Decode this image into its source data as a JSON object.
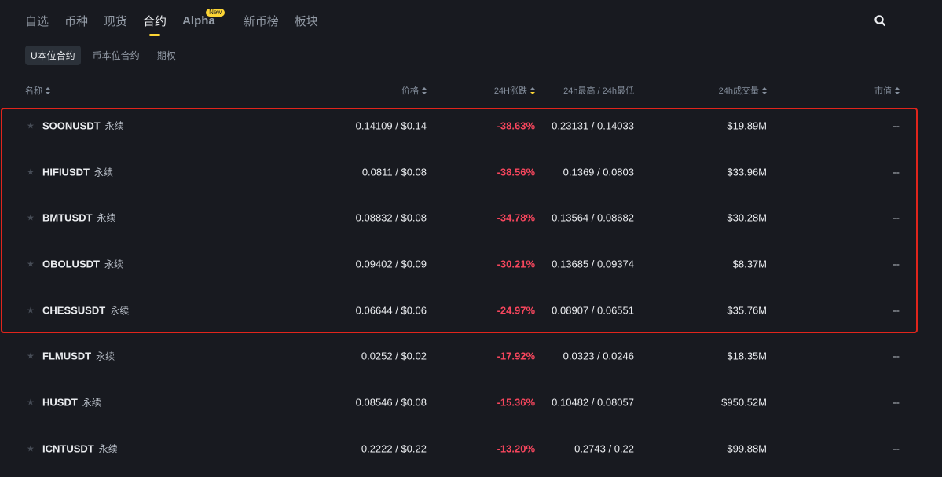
{
  "nav": {
    "tabs": [
      "自选",
      "币种",
      "现货",
      "合约",
      "Alpha",
      "新币榜",
      "板块"
    ],
    "active": "合约",
    "alpha_badge": "New"
  },
  "sub_tabs": [
    "U本位合约",
    "币本位合约",
    "期权"
  ],
  "columns": {
    "name": "名称",
    "price": "价格",
    "change": "24H涨跌",
    "high_low": "24h最高 / 24h最低",
    "volume": "24h成交量",
    "market_cap": "市值"
  },
  "rows": [
    {
      "symbol": "SOONUSDT",
      "type": "永续",
      "price": "0.14109 / $0.14",
      "change": "-38.63%",
      "high_low": "0.23131 / 0.14033",
      "volume": "$19.89M",
      "market_cap": "--"
    },
    {
      "symbol": "HIFIUSDT",
      "type": "永续",
      "price": "0.0811 / $0.08",
      "change": "-38.56%",
      "high_low": "0.1369 / 0.0803",
      "volume": "$33.96M",
      "market_cap": "--"
    },
    {
      "symbol": "BMTUSDT",
      "type": "永续",
      "price": "0.08832 / $0.08",
      "change": "-34.78%",
      "high_low": "0.13564 / 0.08682",
      "volume": "$30.28M",
      "market_cap": "--"
    },
    {
      "symbol": "OBOLUSDT",
      "type": "永续",
      "price": "0.09402 / $0.09",
      "change": "-30.21%",
      "high_low": "0.13685 / 0.09374",
      "volume": "$8.37M",
      "market_cap": "--"
    },
    {
      "symbol": "CHESSUSDT",
      "type": "永续",
      "price": "0.06644 / $0.06",
      "change": "-24.97%",
      "high_low": "0.08907 / 0.06551",
      "volume": "$35.76M",
      "market_cap": "--"
    },
    {
      "symbol": "FLMUSDT",
      "type": "永续",
      "price": "0.0252 / $0.02",
      "change": "-17.92%",
      "high_low": "0.0323 / 0.0246",
      "volume": "$18.35M",
      "market_cap": "--"
    },
    {
      "symbol": "HUSDT",
      "type": "永续",
      "price": "0.08546 / $0.08",
      "change": "-15.36%",
      "high_low": "0.10482 / 0.08057",
      "volume": "$950.52M",
      "market_cap": "--"
    },
    {
      "symbol": "ICNTUSDT",
      "type": "永续",
      "price": "0.2222 / $0.22",
      "change": "-13.20%",
      "high_low": "0.2743 / 0.22",
      "volume": "$99.88M",
      "market_cap": "--"
    }
  ],
  "colors": {
    "background": "#181a20",
    "accent": "#fcd535",
    "negative": "#f6465d",
    "highlight_box": "#e0251c"
  }
}
